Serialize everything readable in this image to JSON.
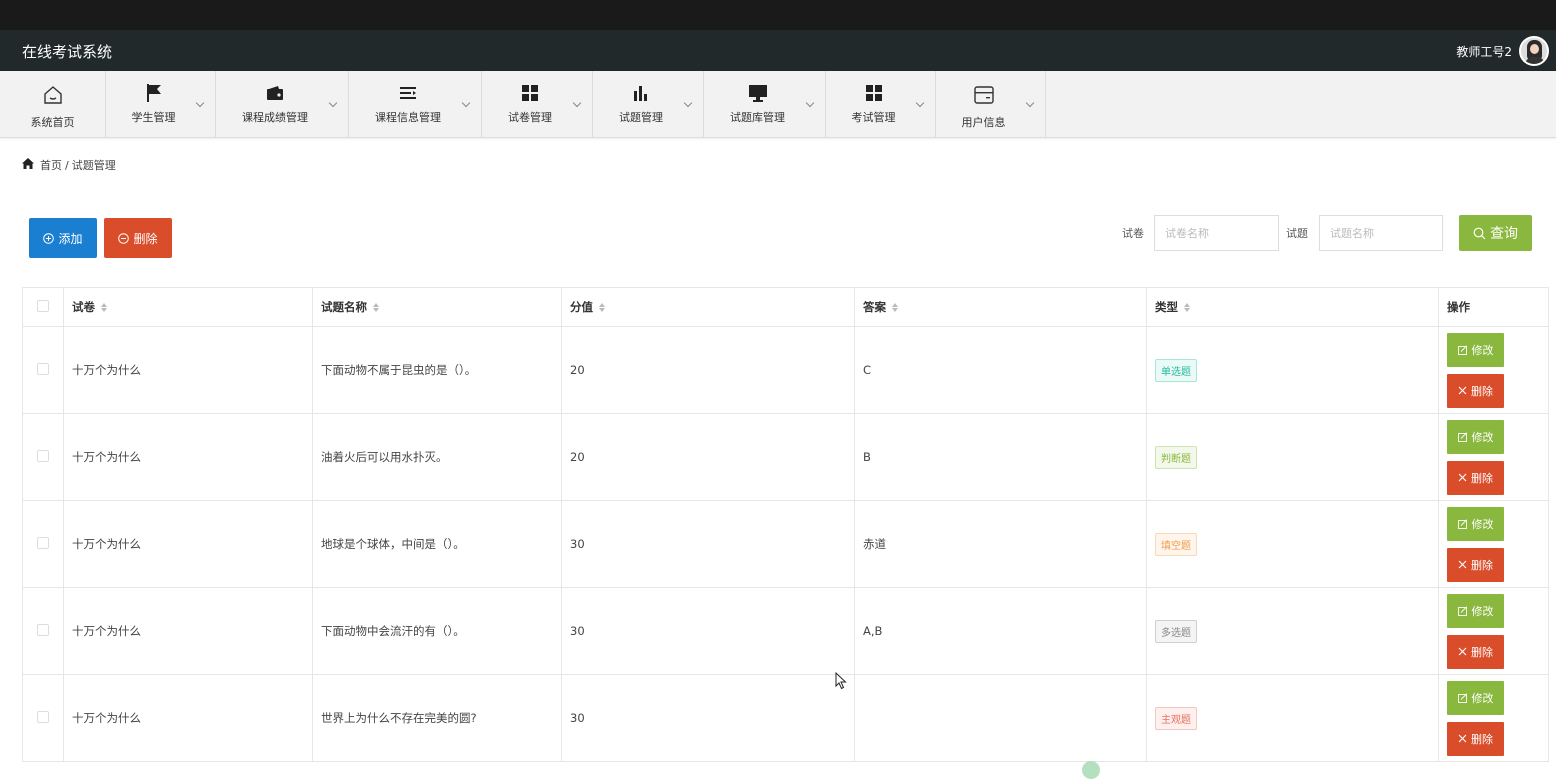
{
  "app": {
    "title": "在线考试系统",
    "user": "教师工号2"
  },
  "nav": [
    {
      "label": "系统首页",
      "icon": "home-icon"
    },
    {
      "label": "学生管理",
      "icon": "flag-icon"
    },
    {
      "label": "课程成绩管理",
      "icon": "wallet-icon"
    },
    {
      "label": "课程信息管理",
      "icon": "list-icon"
    },
    {
      "label": "试卷管理",
      "icon": "grid-icon"
    },
    {
      "label": "试题管理",
      "icon": "bar-chart-icon"
    },
    {
      "label": "试题库管理",
      "icon": "monitor-icon"
    },
    {
      "label": "考试管理",
      "icon": "grid-icon"
    },
    {
      "label": "用户信息",
      "icon": "card-icon"
    }
  ],
  "breadcrumb": {
    "home": "首页",
    "separator": "/",
    "current": "试题管理"
  },
  "toolbar": {
    "add_label": "添加",
    "delete_label": "删除",
    "paper_label": "试卷",
    "paper_placeholder": "试卷名称",
    "question_label": "试题",
    "question_placeholder": "试题名称",
    "search_label": "查询"
  },
  "table": {
    "headers": [
      "试卷",
      "试题名称",
      "分值",
      "答案",
      "类型",
      "操作"
    ],
    "edit_label": "修改",
    "delete_label": "删除",
    "rows": [
      {
        "paper": "十万个为什么",
        "question": "下面动物不属于昆虫的是（）。",
        "score": "20",
        "answer": "C",
        "type": "单选题",
        "type_color": "#27b9a1",
        "type_bg": "#eafaf6"
      },
      {
        "paper": "十万个为什么",
        "question": "油着火后可以用水扑灭。",
        "score": "20",
        "answer": "B",
        "type": "判断题",
        "type_color": "#8ab73e",
        "type_bg": "#f3f9ea"
      },
      {
        "paper": "十万个为什么",
        "question": "地球是个球体，中间是（）。",
        "score": "30",
        "answer": "赤道",
        "type": "填空题",
        "type_color": "#f39c4a",
        "type_bg": "#fef5ec"
      },
      {
        "paper": "十万个为什么",
        "question": "下面动物中会流汗的有（）。",
        "score": "30",
        "answer": "A,B",
        "type": "多选题",
        "type_color": "#888888",
        "type_bg": "#f4f4f4"
      },
      {
        "paper": "十万个为什么",
        "question": "世界上为什么不存在完美的圆?",
        "score": "30",
        "answer": "",
        "type": "主观题",
        "type_color": "#e8715e",
        "type_bg": "#fdf0ee"
      }
    ]
  }
}
